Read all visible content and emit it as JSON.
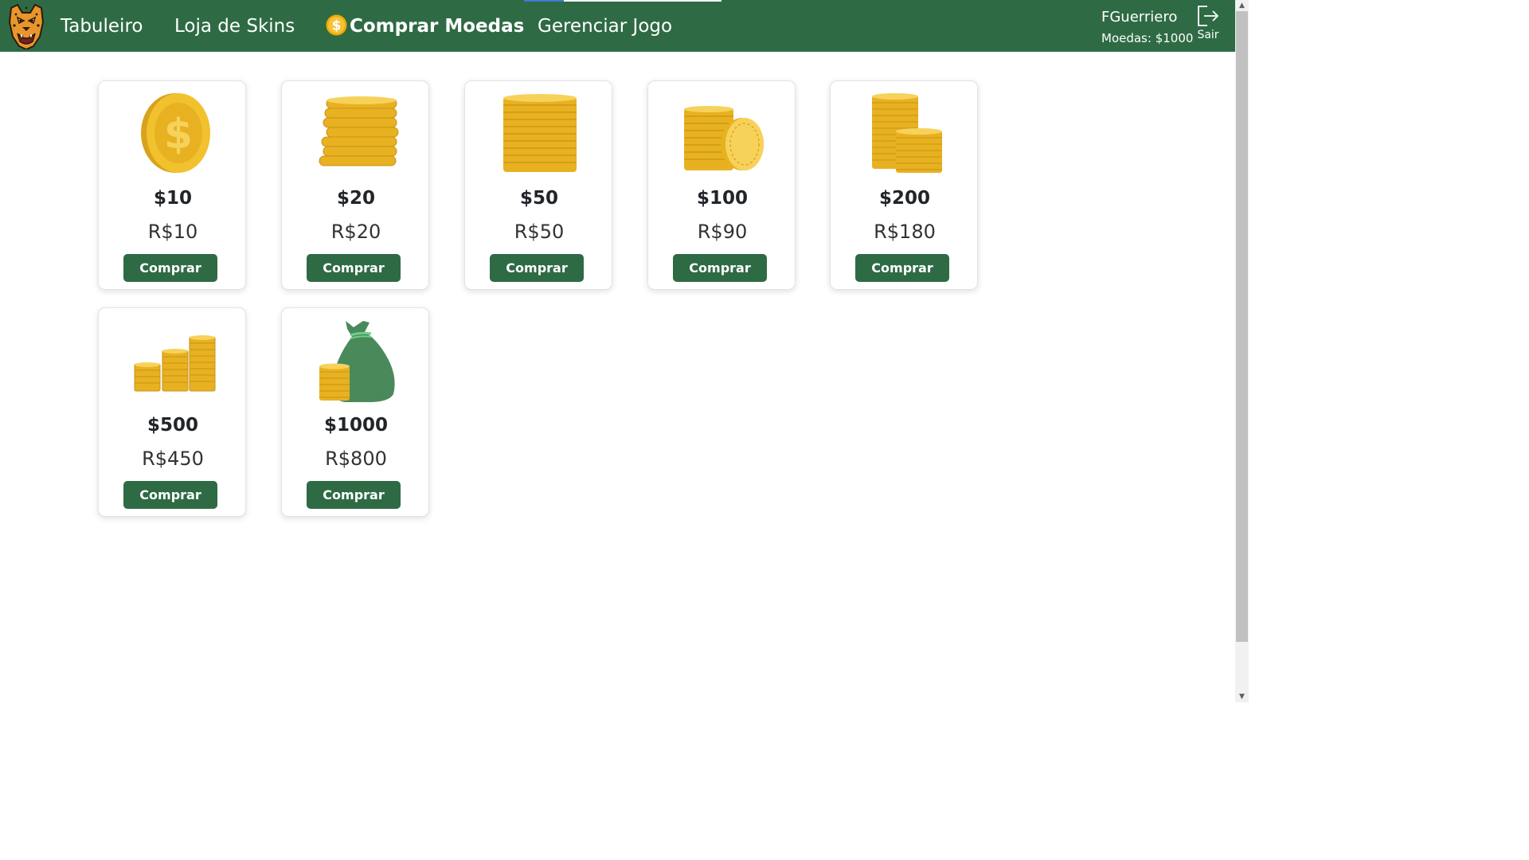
{
  "colors": {
    "nav_bg": "#2e6b44",
    "button_bg": "#2e6b44",
    "coin_gold": "#f2c12e",
    "coin_dark": "#d9a21b",
    "bag_green": "#4a8a5a"
  },
  "nav": {
    "logo_icon": "jaguar-logo-icon",
    "links": [
      {
        "label": "Tabuleiro"
      },
      {
        "label": "Loja de Skins"
      },
      {
        "label": "Comprar Moedas",
        "icon": "coin-icon",
        "active": true
      },
      {
        "label": "Gerenciar Jogo"
      }
    ]
  },
  "user": {
    "name": "FGuerriero",
    "coins_text": "Moedas: $1000",
    "logout_label": "Sair",
    "logout_icon": "logout-icon"
  },
  "packages": [
    {
      "amount": "$10",
      "price": "R$10",
      "button": "Comprar",
      "icon": "single-coin-icon"
    },
    {
      "amount": "$20",
      "price": "R$20",
      "button": "Comprar",
      "icon": "coin-stack-icon"
    },
    {
      "amount": "$50",
      "price": "R$50",
      "button": "Comprar",
      "icon": "tall-coin-stack-icon"
    },
    {
      "amount": "$100",
      "price": "R$90",
      "button": "Comprar",
      "icon": "coin-stack-with-coin-icon"
    },
    {
      "amount": "$200",
      "price": "R$180",
      "button": "Comprar",
      "icon": "double-coin-stack-icon"
    },
    {
      "amount": "$500",
      "price": "R$450",
      "button": "Comprar",
      "icon": "three-coin-stacks-icon"
    },
    {
      "amount": "$1000",
      "price": "R$800",
      "button": "Comprar",
      "icon": "money-bag-icon"
    }
  ]
}
